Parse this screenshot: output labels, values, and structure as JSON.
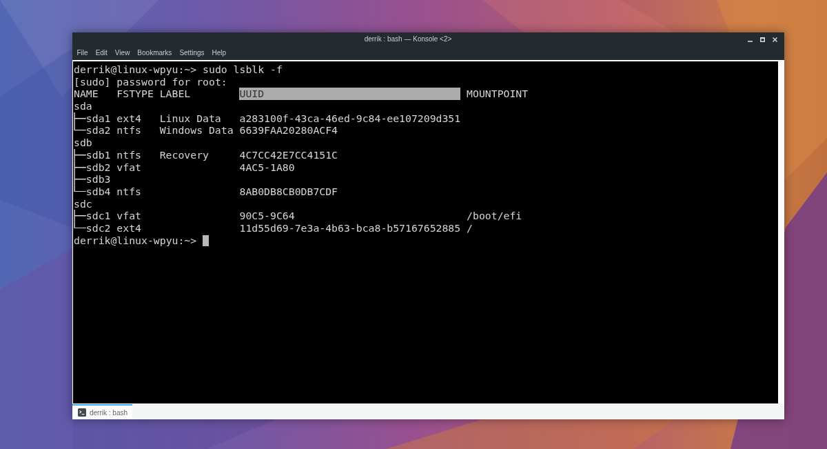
{
  "window": {
    "title": "derrik : bash — Konsole <2>"
  },
  "menu_bar": [
    "File",
    "Edit",
    "View",
    "Bookmarks",
    "Settings",
    "Help"
  ],
  "terminal": {
    "lines": [
      "derrik@linux-wpyu:~> sudo lsblk -f",
      "[sudo] password for root:"
    ],
    "table": {
      "columns": [
        {
          "label": "NAME",
          "selected": false
        },
        {
          "label": "FSTYPE",
          "selected": false
        },
        {
          "label": "LABEL",
          "selected": false
        },
        {
          "label": "UUID",
          "selected": true
        },
        {
          "label": "MOUNTPOINT",
          "selected": false
        }
      ],
      "rows": [
        {
          "name": "sda",
          "children": [
            {
              "name": "sda1",
              "fstype": "ext4",
              "label": "Linux Data",
              "uuid": "a283100f-43ca-46ed-9c84-ee107209d351"
            },
            {
              "name": "sda2",
              "fstype": "ntfs",
              "label": "Windows Data",
              "uuid": "6639FAA20280ACF4"
            }
          ]
        },
        {
          "name": "sdb",
          "children": [
            {
              "name": "sdb1",
              "fstype": "ntfs",
              "label": "Recovery",
              "uuid": "4C7CC42E7CC4151C"
            },
            {
              "name": "sdb2",
              "fstype": "vfat",
              "uuid": "4AC5-1A80"
            },
            {
              "name": "sdb3"
            },
            {
              "name": "sdb4",
              "fstype": "ntfs",
              "uuid": "8AB0DB8CB0DB7CDF"
            }
          ]
        },
        {
          "name": "sdc",
          "children": [
            {
              "name": "sdc1",
              "fstype": "vfat",
              "uuid": "90C5-9C64",
              "mountpoint": "/boot/efi"
            },
            {
              "name": "sdc2",
              "fstype": "ext4",
              "uuid": "11d55d69-7e3a-4b63-bca8-b57167652885",
              "mountpoint": "/"
            }
          ]
        }
      ]
    },
    "prompt": "derrik@linux-wpyu:~>",
    "cursor": true
  },
  "tabs": [
    {
      "label": "derrik : bash",
      "selected": true
    }
  ]
}
